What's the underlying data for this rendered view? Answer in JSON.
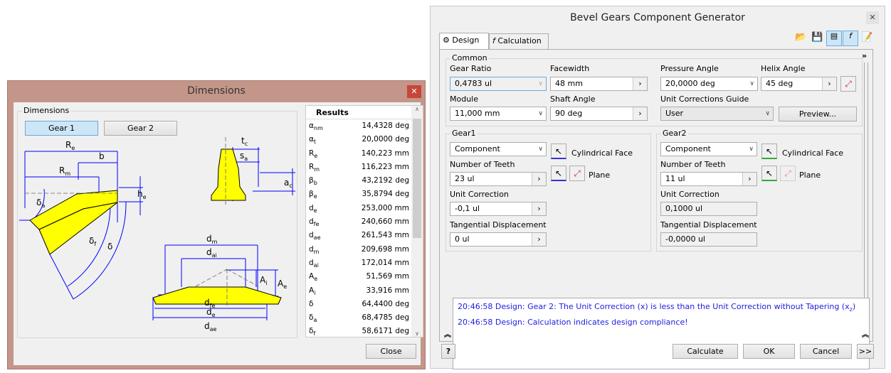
{
  "dimensions_window": {
    "title": "Dimensions",
    "close_icon": "close-icon",
    "group_label": "Dimensions",
    "gear_buttons": [
      "Gear 1",
      "Gear 2"
    ],
    "selected_gear": "Gear 1",
    "diagram_labels": {
      "Re": [
        "R",
        "e"
      ],
      "b": [
        "b",
        ""
      ],
      "Rm": [
        "R",
        "m"
      ],
      "delta_a": [
        "δ",
        "a"
      ],
      "he": [
        "h",
        "e"
      ],
      "delta_f": [
        "δ",
        "f"
      ],
      "delta": [
        "δ",
        ""
      ],
      "tc": [
        "t",
        "c"
      ],
      "sa": [
        "s",
        "a"
      ],
      "ac": [
        "a",
        "c"
      ],
      "dm": [
        "d",
        "m"
      ],
      "dai": [
        "d",
        "ai"
      ],
      "Ai": [
        "A",
        "i"
      ],
      "Ae": [
        "A",
        "e"
      ],
      "dfe": [
        "d",
        "fe"
      ],
      "de": [
        "d",
        "e"
      ],
      "dae": [
        "d",
        "ae"
      ]
    },
    "results": {
      "header": "Results",
      "rows": [
        {
          "sym": "α",
          "sub": "nm",
          "value": "14,4328 deg"
        },
        {
          "sym": "α",
          "sub": "t",
          "value": "20,0000 deg"
        },
        {
          "sym": "R",
          "sub": "e",
          "value": "140,223 mm"
        },
        {
          "sym": "R",
          "sub": "m",
          "value": "116,223 mm"
        },
        {
          "sym": "β",
          "sub": "b",
          "value": "43,2192 deg"
        },
        {
          "sym": "β",
          "sub": "e",
          "value": "35,8794 deg"
        },
        {
          "sym": "d",
          "sub": "e",
          "value": "253,000 mm"
        },
        {
          "sym": "d",
          "sub": "fe",
          "value": "240,660 mm"
        },
        {
          "sym": "d",
          "sub": "ae",
          "value": "261,543 mm"
        },
        {
          "sym": "d",
          "sub": "m",
          "value": "209,698 mm"
        },
        {
          "sym": "d",
          "sub": "ai",
          "value": "172,014 mm"
        },
        {
          "sym": "A",
          "sub": "e",
          "value": "51,569 mm"
        },
        {
          "sym": "A",
          "sub": "i",
          "value": "33,916 mm"
        },
        {
          "sym": "δ",
          "sub": "",
          "value": "64,4400 deg"
        },
        {
          "sym": "δ",
          "sub": "a",
          "value": "68,4785 deg"
        },
        {
          "sym": "δ",
          "sub": "f",
          "value": "58,6171 deg"
        }
      ]
    },
    "close_button": "Close",
    "colors": {
      "titlebar": "#c4968a",
      "gear_fill": "#ffff00",
      "dimension_lines": "#0000ff"
    }
  },
  "bevel_window": {
    "title": "Bevel Gears Component Generator",
    "tabs": [
      "Design",
      "Calculation"
    ],
    "active_tab": "Design",
    "common": {
      "label": "Common",
      "gear_ratio": {
        "label": "Gear Ratio",
        "value": "0,4783 ul"
      },
      "facewidth": {
        "label": "Facewidth",
        "value": "48 mm"
      },
      "pressure_angle": {
        "label": "Pressure Angle",
        "value": "20,0000 deg"
      },
      "helix_angle": {
        "label": "Helix Angle",
        "value": "45 deg"
      },
      "module": {
        "label": "Module",
        "value": "11,000 mm"
      },
      "shaft_angle": {
        "label": "Shaft Angle",
        "value": "90 deg"
      },
      "unit_corrections_guide": {
        "label": "Unit Corrections Guide",
        "value": "User"
      },
      "preview_button": "Preview..."
    },
    "gear1": {
      "label": "Gear1",
      "type": "Component",
      "face": "Cylindrical Face",
      "plane": "Plane",
      "teeth_label": "Number of Teeth",
      "teeth": "23 ul",
      "unit_correction_label": "Unit Correction",
      "unit_correction": "-0,1 ul",
      "tangential_label": "Tangential Displacement",
      "tangential": "0 ul"
    },
    "gear2": {
      "label": "Gear2",
      "type": "Component",
      "face": "Cylindrical Face",
      "plane": "Plane",
      "teeth_label": "Number of Teeth",
      "teeth": "11 ul",
      "unit_correction_label": "Unit Correction",
      "unit_correction": "0,1000 ul",
      "tangential_label": "Tangential Displacement",
      "tangential": "-0,0000 ul"
    },
    "messages": [
      {
        "text": "20:46:58 Design: Gear 2: The Unit Correction (x) is less than the Unit Correction without Tapering (x",
        "sub": "z",
        "end": ")"
      },
      {
        "text": "20:46:58 Design: Calculation indicates design compliance!",
        "sub": "",
        "end": ""
      }
    ],
    "buttons": {
      "help": "?",
      "calculate": "Calculate",
      "ok": "OK",
      "cancel": "Cancel",
      "more": ">>"
    },
    "message_color": "#1d1de0"
  }
}
